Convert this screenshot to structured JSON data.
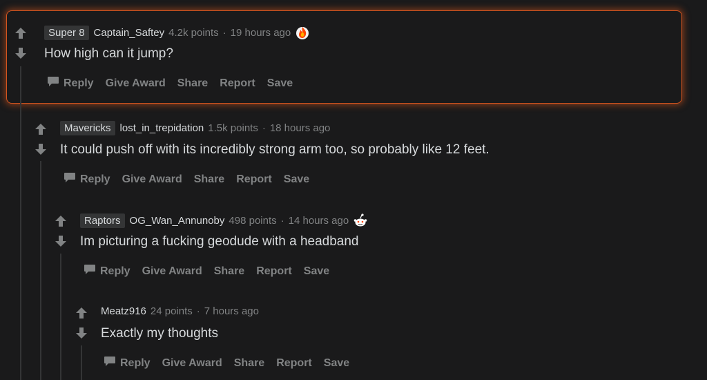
{
  "comments": [
    {
      "flair": "Super 8",
      "author": "Captain_Saftey",
      "points": "4.2k points",
      "time": "19 hours ago",
      "award_icon": "fire-award-icon",
      "body": "How high can it jump?"
    },
    {
      "flair": "Mavericks",
      "author": "lost_in_trepidation",
      "points": "1.5k points",
      "time": "18 hours ago",
      "body": "It could push off with its incredibly strong arm too, so probably like 12 feet."
    },
    {
      "flair": "Raptors",
      "author": "OG_Wan_Annunoby",
      "points": "498 points",
      "time": "14 hours ago",
      "award_icon": "snoo-award-icon",
      "body": "Im picturing a fucking geodude with a headband"
    },
    {
      "author": "Meatz916",
      "points": "24 points",
      "time": "7 hours ago",
      "body": "Exactly my thoughts"
    }
  ],
  "actions": {
    "reply": "Reply",
    "give_award": "Give Award",
    "share": "Share",
    "report": "Report",
    "save": "Save"
  },
  "separator": "·",
  "colors": {
    "background": "#1a1a1b",
    "highlight_border": "#d3551f",
    "text": "#d7dadc",
    "muted": "#818384"
  }
}
